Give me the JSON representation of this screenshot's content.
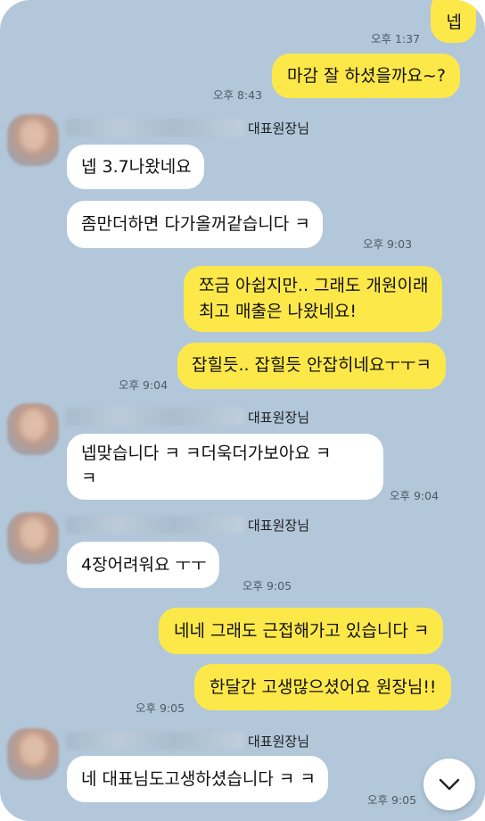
{
  "messages": [
    {
      "text": "넵",
      "time": "오후 1:37"
    },
    {
      "text": "마감 잘 하셨을까요~?",
      "time": "오후 8:43"
    },
    {
      "sender": "대표원장님",
      "text": "넵 3.7나왔네요"
    },
    {
      "text": "좀만더하면 다가올꺼같습니다 ㅋ",
      "time": "오후 9:03"
    },
    {
      "line1": "쪼금 아쉽지만.. 그래도 개원이래",
      "line2": "최고 매출은 나왔네요!"
    },
    {
      "text": "잡힐듯.. 잡힐듯 안잡히네요ㅜㅜㅋ",
      "time": "오후 9:04"
    },
    {
      "sender": "대표원장님",
      "line1": "넵맞습니다 ㅋ ㅋ더욱더가보아요 ㅋ",
      "line2": "ㅋ",
      "time": "오후 9:04"
    },
    {
      "sender": "대표원장님",
      "text": "4장어려워요 ㅜㅜ",
      "time": "오후 9:05"
    },
    {
      "text": "네네 그래도 근접해가고 있습니다 ㅋ"
    },
    {
      "text": "한달간 고생많으셨어요 원장님!!",
      "time": "오후 9:05"
    },
    {
      "sender": "대표원장님",
      "text": "네 대표님도고생하셨습니다 ㅋ ㅋ",
      "time": "오후 9:05"
    }
  ],
  "colors": {
    "background": "#b2c7da",
    "my_bubble": "#fde84a",
    "their_bubble": "#ffffff"
  },
  "icons": {
    "scroll_down": "chevron-down-icon"
  }
}
